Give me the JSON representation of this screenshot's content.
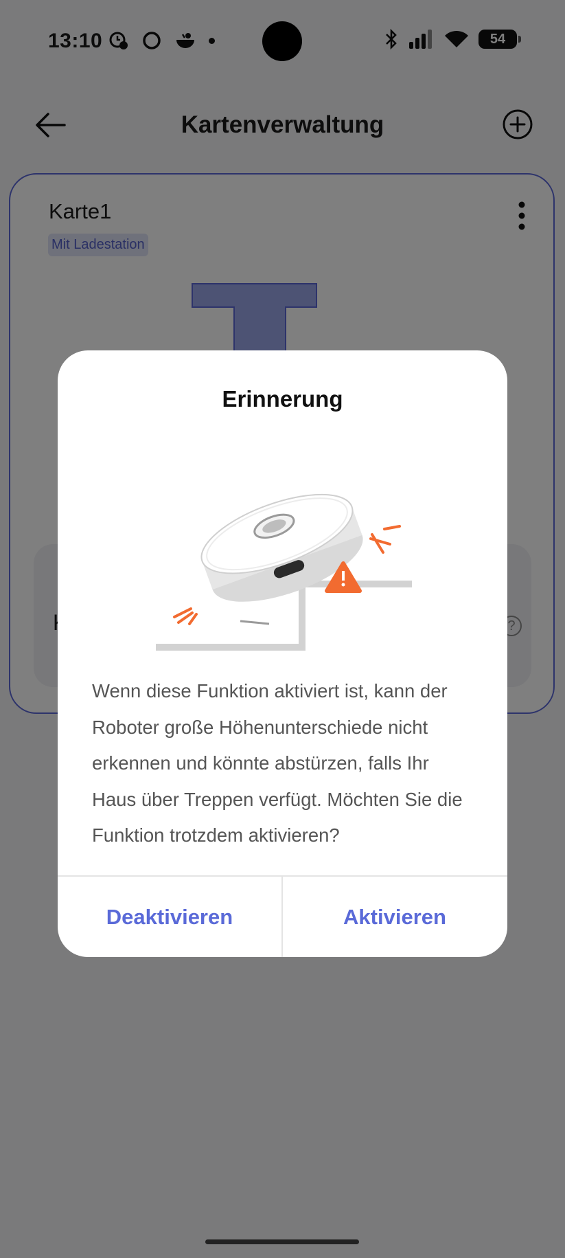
{
  "status_bar": {
    "time": "13:10",
    "battery": "54",
    "left_icons": [
      "alarm-icon",
      "circle-app-icon",
      "bowl-app-icon",
      "notification-dot-icon"
    ],
    "right_icons": [
      "bluetooth-icon",
      "signal-icon",
      "wifi-icon",
      "battery-icon"
    ]
  },
  "header": {
    "title": "Kartenverwaltung",
    "back_icon": "arrow-left-icon",
    "add_icon": "plus-circle-icon"
  },
  "map_card": {
    "name": "Karte1",
    "badge": "Mit Ladestation",
    "more_icon": "more-vertical-icon",
    "accent_color": "#5b67d6"
  },
  "sub_card": {
    "label_fragment": "K",
    "help_icon": "help-circle-icon",
    "help_glyph": "?"
  },
  "dialog": {
    "title": "Erinnerung",
    "illustration": "robot-vacuum-falling-stairs-illustration",
    "body": "Wenn diese Funktion aktiviert ist, kann der Roboter große Höhenunterschiede nicht erkennen und könnte abstürzen, falls Ihr Haus über Treppen verfügt. Möchten Sie die Funktion trotzdem aktivieren?",
    "cancel_label": "Deaktivieren",
    "confirm_label": "Aktivieren",
    "button_color": "#5a6ad8",
    "warning_color": "#f26b30"
  }
}
